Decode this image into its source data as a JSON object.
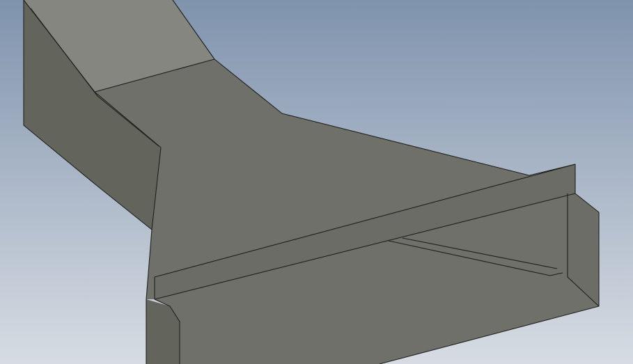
{
  "viewport": {
    "background_top": "#7f93ad",
    "background_bottom": "#d7dce3",
    "model": "sheet-metal-transition-duct"
  },
  "colors": {
    "face_top": "#6f706a",
    "face_upper_ramp": "#858680",
    "face_left_wall": "#63645c",
    "face_flange": "#6b6c65",
    "face_inner_wall": "#86867a",
    "face_inner_shadow": "#5e5f58",
    "face_right_cap": "#6c6d66",
    "highlight_strip": "#e4e3d4",
    "edge": "#1e1f1c"
  }
}
